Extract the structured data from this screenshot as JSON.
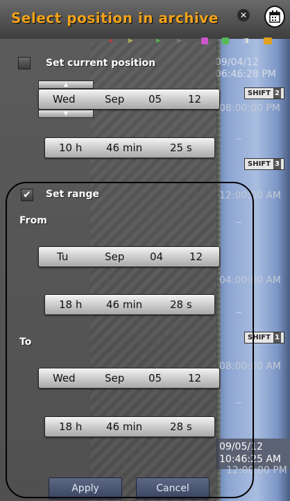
{
  "window": {
    "title": "Select position in archive"
  },
  "current_position": {
    "label": "Set current position",
    "date": {
      "weekday": "Wed",
      "month": "Sep",
      "day": "05",
      "year": "12"
    },
    "time": {
      "hours": "10 h",
      "minutes": "46 min",
      "seconds": "25 s"
    }
  },
  "range": {
    "label": "Set range",
    "checked": true,
    "from_label": "From",
    "from_date": {
      "weekday": "Tu",
      "month": "Sep",
      "day": "04",
      "year": "12"
    },
    "from_time": {
      "hours": "18 h",
      "minutes": "46 min",
      "seconds": "28 s"
    },
    "to_label": "To",
    "to_date": {
      "weekday": "Wed",
      "month": "Sep",
      "day": "05",
      "year": "12"
    },
    "to_time": {
      "hours": "18 h",
      "minutes": "46 min",
      "seconds": "28 s"
    }
  },
  "buttons": {
    "apply": "Apply",
    "cancel": "Cancel"
  },
  "timeline": {
    "top_date": "09/04/12",
    "top_time": "06:46:28 PM",
    "badge": "5",
    "shift_label": "SHIFT",
    "shift_nums": [
      "2",
      "3",
      "1"
    ],
    "marks": [
      "08:00:00 PM",
      "12:00:00 AM",
      "04:00:00 AM",
      "08:00:00 AM",
      "12:00:00 PM"
    ],
    "cursor_date": "09/05/12",
    "cursor_time": "10:46:25 AM"
  },
  "colors": {
    "title": "#f2a31a",
    "button": "#4a5572",
    "field": "#d0d0d0"
  }
}
